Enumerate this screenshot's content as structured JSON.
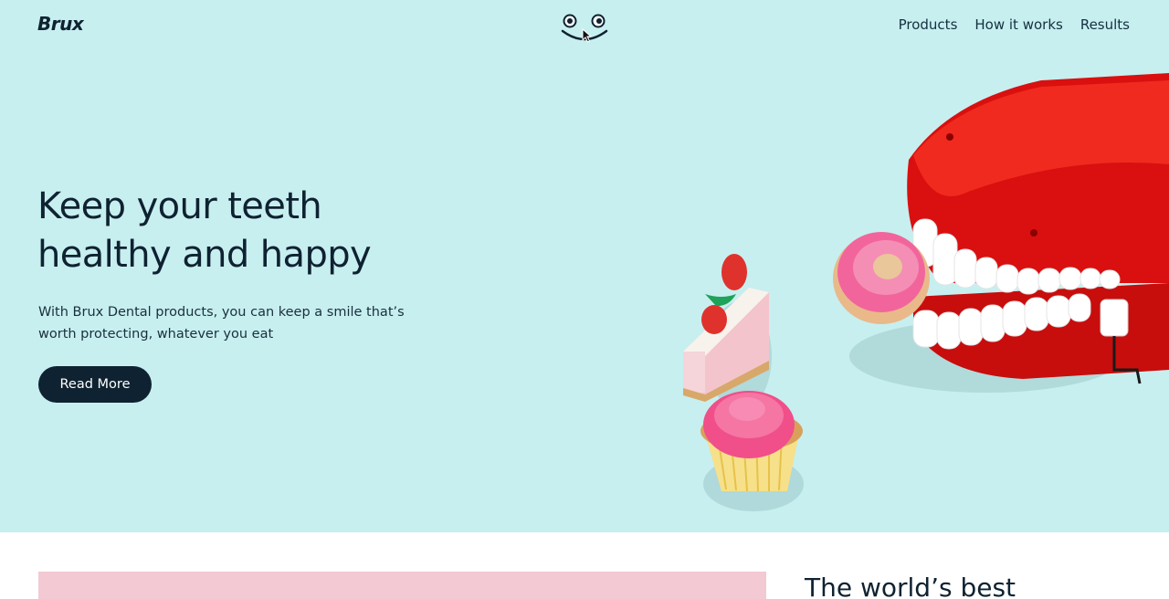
{
  "brand": {
    "name": "Brux"
  },
  "nav": {
    "links": [
      "Products",
      "How it works",
      "Results"
    ]
  },
  "hero": {
    "title_line1": "Keep your teeth",
    "title_line2": "healthy and happy",
    "text": "With Brux Dental products, you can keep a smile that’s worth protecting, whatever you eat",
    "button_label": "Read More"
  },
  "section2": {
    "title": "The world’s best"
  },
  "colors": {
    "hero_bg": "#c7eff0",
    "ink": "#0f2231",
    "accent_red": "#e11616",
    "pink": "#f3c9d4"
  },
  "icons": {
    "logo_face": "smiley-face-icon",
    "cursor": "mouse-cursor-icon"
  }
}
